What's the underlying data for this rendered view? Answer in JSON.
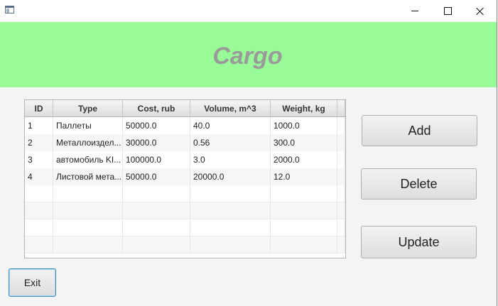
{
  "window": {
    "controls": {
      "minimize_icon": "minimize-icon",
      "maximize_icon": "maximize-icon",
      "close_icon": "close-icon"
    }
  },
  "header": {
    "title": "Cargo",
    "background": "#99fb98",
    "title_color": "#9a9a9a"
  },
  "table": {
    "columns": [
      "ID",
      "Type",
      "Cost, rub",
      "Volume, m^3",
      "Weight, kg"
    ],
    "rows": [
      [
        "1",
        "Паллеты",
        "50000.0",
        "40.0",
        "1000.0"
      ],
      [
        "2",
        "Металлоиздел...",
        "30000.0",
        "0.56",
        "300.0"
      ],
      [
        "3",
        "автомобиль KI...",
        "100000.0",
        "3.0",
        "2000.0"
      ],
      [
        "4",
        "Листовой мета...",
        "50000.0",
        "20000.0",
        "12.0"
      ]
    ]
  },
  "buttons": {
    "add": "Add",
    "delete": "Delete",
    "update": "Update",
    "exit": "Exit"
  }
}
